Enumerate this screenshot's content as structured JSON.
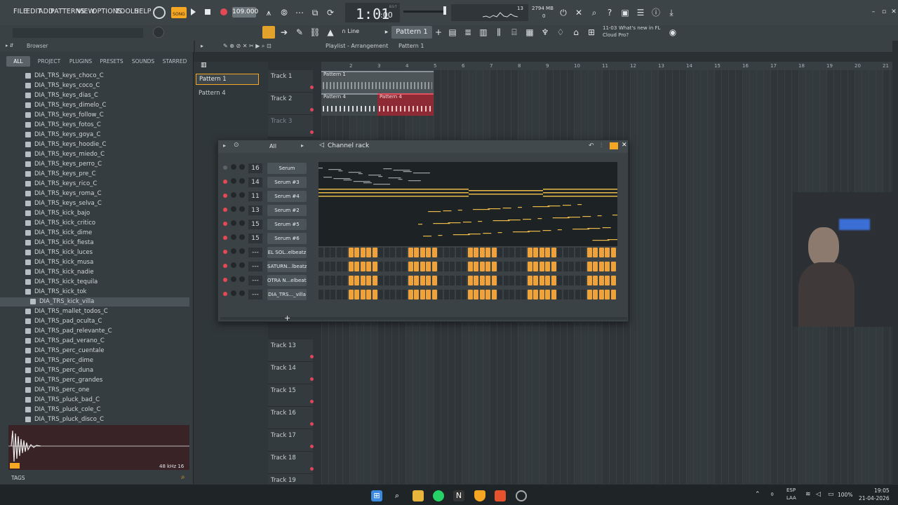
{
  "menu": [
    "FILE",
    "EDIT",
    "ADD",
    "PATTERNS",
    "VIEW",
    "OPTIONS",
    "TOOLS",
    "HELP"
  ],
  "transport": {
    "song_label": "SONG",
    "tempo": "109.000",
    "time": "1:01",
    "time_sub": ":00",
    "time_unit": "B:S:T",
    "cpu_num": "13",
    "ram": "2794 MB",
    "ram_sub": "0"
  },
  "toolbar2": {
    "snap": "Line",
    "pattern": "Pattern 1",
    "news_date": "11-03",
    "news_title": "What's new in FL",
    "news_sub": "Cloud Pro?"
  },
  "browser": {
    "title": "Browser",
    "tabs": [
      "ALL",
      "PROJECT",
      "PLUGINS",
      "PRESETS",
      "SOUNDS",
      "STARRED"
    ],
    "items": [
      "DIA_TRS_keys_choco_C",
      "DIA_TRS_keys_coco_C",
      "DIA_TRS_keys_dias_C",
      "DIA_TRS_keys_dimelo_C",
      "DIA_TRS_keys_follow_C",
      "DIA_TRS_keys_fotos_C",
      "DIA_TRS_keys_goya_C",
      "DIA_TRS_keys_hoodie_C",
      "DIA_TRS_keys_miedo_C",
      "DIA_TRS_keys_perro_C",
      "DIA_TRS_keys_pre_C",
      "DIA_TRS_keys_rico_C",
      "DIA_TRS_keys_roma_C",
      "DIA_TRS_keys_selva_C",
      "DIA_TRS_kick_bajo",
      "DIA_TRS_kick_critico",
      "DIA_TRS_kick_dime",
      "DIA_TRS_kick_fiesta",
      "DIA_TRS_kick_luces",
      "DIA_TRS_kick_musa",
      "DIA_TRS_kick_nadie",
      "DIA_TRS_kick_tequila",
      "DIA_TRS_kick_tok",
      "DIA_TRS_kick_villa",
      "DIA_TRS_mallet_todos_C",
      "DIA_TRS_pad_oculta_C",
      "DIA_TRS_pad_relevante_C",
      "DIA_TRS_pad_verano_C",
      "DIA_TRS_perc_cuentale",
      "DIA_TRS_perc_dime",
      "DIA_TRS_perc_duna",
      "DIA_TRS_perc_grandes",
      "DIA_TRS_perc_one",
      "DIA_TRS_pluck_bad_C",
      "DIA_TRS_pluck_cole_C",
      "DIA_TRS_pluck_disco_C"
    ],
    "selected_index": 23,
    "sample_info": "48 kHz 16",
    "tags_label": "TAGS"
  },
  "playlist": {
    "title": "Playlist - Arrangement",
    "pattern": "Pattern 1",
    "patterns": [
      "Pattern 1",
      "Pattern 4"
    ],
    "ruler": [
      "2",
      "3",
      "4",
      "5",
      "6",
      "7",
      "8",
      "9",
      "10",
      "11",
      "12",
      "13",
      "14",
      "15",
      "16",
      "17",
      "18",
      "19",
      "20",
      "21"
    ],
    "tracks": [
      "Track 1",
      "Track 2",
      "Track 3",
      "Track 13",
      "Track 14",
      "Track 15",
      "Track 16",
      "Track 17",
      "Track 18",
      "Track 19"
    ],
    "clips": [
      {
        "label": "Pattern 1"
      },
      {
        "label": "Pattern 4"
      },
      {
        "label": "Pattern 4"
      }
    ]
  },
  "channel_rack": {
    "title": "Channel rack",
    "filter": "All",
    "channels": [
      {
        "num": "16",
        "name": "Serum"
      },
      {
        "num": "14",
        "name": "Serum #3"
      },
      {
        "num": "11",
        "name": "Serum #4"
      },
      {
        "num": "13",
        "name": "Serum #2"
      },
      {
        "num": "15",
        "name": "Serum #5"
      },
      {
        "num": "15",
        "name": "Serum #6"
      },
      {
        "num": "---",
        "name": "EL SOL..elbeatz"
      },
      {
        "num": "---",
        "name": "SATURN...lbeatz"
      },
      {
        "num": "---",
        "name": "OTRA N...elbeatz"
      },
      {
        "num": "---",
        "name": "DIA_TRS..._villa"
      }
    ],
    "add_label": "+"
  },
  "taskbar": {
    "lang": "ESP",
    "lang_sub": "LAA",
    "battery": "100%",
    "time": "19:05",
    "date": "21-04-2026"
  },
  "colors": {
    "accent": "#f5a623",
    "record": "#e34a55",
    "clip_red": "#b8323c",
    "note": "#e8b84a"
  }
}
